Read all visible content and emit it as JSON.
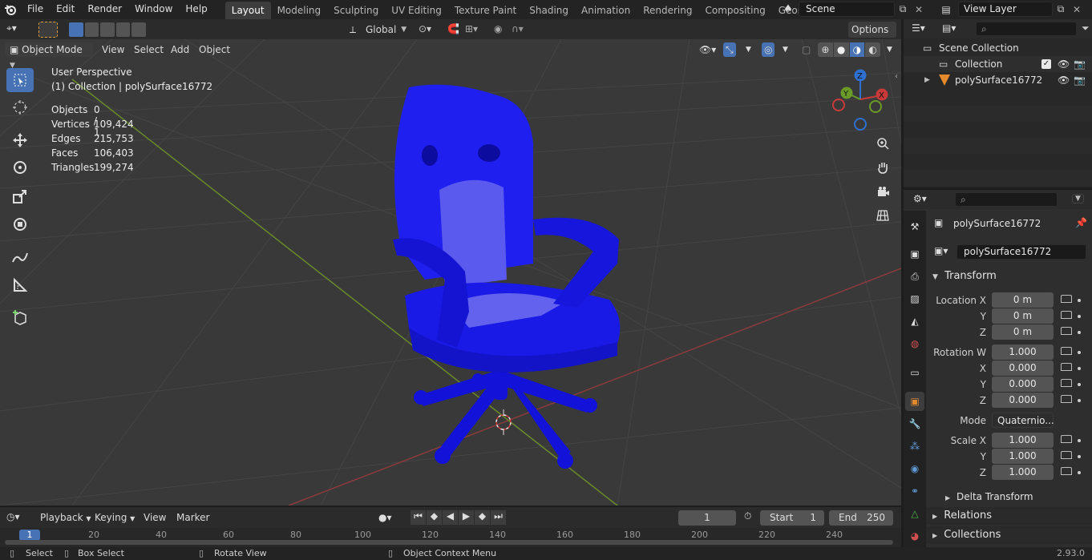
{
  "topbar": {
    "menus": [
      "File",
      "Edit",
      "Render",
      "Window",
      "Help"
    ],
    "workspaces": [
      "Layout",
      "Modeling",
      "Sculpting",
      "UV Editing",
      "Texture Paint",
      "Shading",
      "Animation",
      "Rendering",
      "Compositing",
      "Geometry Nod"
    ],
    "active_workspace": "Layout",
    "scene": "Scene",
    "view_layer": "View Layer"
  },
  "tool_header": {
    "orientation": "Global",
    "options": "Options"
  },
  "viewport_header": {
    "mode": "Object Mode",
    "menus": [
      "View",
      "Select",
      "Add",
      "Object"
    ]
  },
  "overlay": {
    "perspective": "User Perspective",
    "collection_line": "(1) Collection | polySurface16772",
    "stats": [
      {
        "label": "Objects",
        "value": "0 / 1"
      },
      {
        "label": "Vertices",
        "value": "109,424"
      },
      {
        "label": "Edges",
        "value": "215,753"
      },
      {
        "label": "Faces",
        "value": "106,403"
      },
      {
        "label": "Triangles",
        "value": "199,274"
      }
    ]
  },
  "gizmo": {
    "x": "X",
    "y": "Y",
    "z": "Z"
  },
  "outliner": {
    "scene_collection": "Scene Collection",
    "collection": "Collection",
    "object": "polySurface16772"
  },
  "properties": {
    "object_name": "polySurface16772",
    "data_name": "polySurface16772",
    "transform_title": "Transform",
    "location_label": "Location X",
    "location": [
      "0 m",
      "0 m",
      "0 m"
    ],
    "rotation_label": "Rotation W",
    "rotation": [
      "1.000",
      "0.000",
      "0.000",
      "0.000"
    ],
    "mode_label": "Mode",
    "mode_value": "Quaternio...",
    "scale_label": "Scale X",
    "scale": [
      "1.000",
      "1.000",
      "1.000"
    ],
    "axis_y": "Y",
    "axis_z": "Z",
    "axis_x": "X",
    "delta_transform": "Delta Transform",
    "relations": "Relations",
    "collections": "Collections"
  },
  "timeline": {
    "menus": [
      "Playback",
      "Keying",
      "View",
      "Marker"
    ],
    "current_frame": "1",
    "start_label": "Start",
    "start": "1",
    "end_label": "End",
    "end": "250",
    "ruler": [
      "1",
      "20",
      "40",
      "60",
      "80",
      "100",
      "120",
      "140",
      "160",
      "180",
      "200",
      "220",
      "240"
    ]
  },
  "statusbar": {
    "select": "Select",
    "box_select": "Box Select",
    "rotate_view": "Rotate View",
    "context_menu": "Object Context Menu",
    "version": "2.93.0"
  },
  "colors": {
    "accent": "#4772b3",
    "chair": "#1818e6",
    "grid_x": "#8a3b3b",
    "grid_y": "#6b8a2a"
  }
}
